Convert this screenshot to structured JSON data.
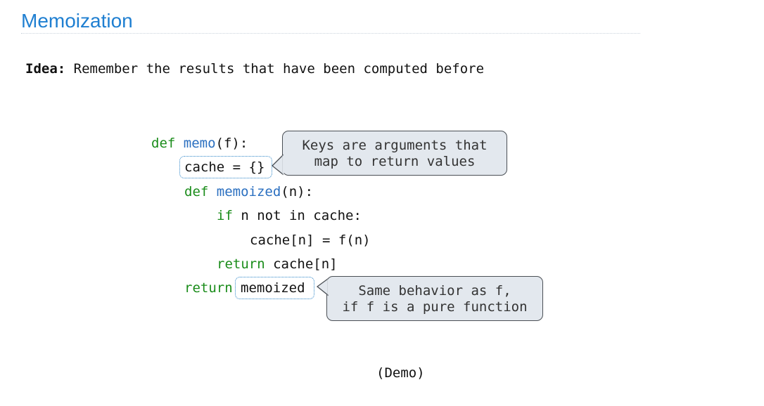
{
  "slide": {
    "title": "Memoization",
    "idea_label": "Idea:",
    "idea_text": " Remember the results that have been computed before",
    "demo": "(Demo)"
  },
  "code": {
    "l1_def": "def",
    "l1_name": "memo",
    "l1_rest": "(f):",
    "l2_text": "cache = {}",
    "l3_def": "def",
    "l3_name": "memoized",
    "l3_rest": "(n):",
    "l4_if": "if",
    "l4_rest": " n not in cache:",
    "l5_text": "cache[n] = f(n)",
    "l6_return": "return",
    "l6_rest": " cache[n]",
    "l7_return": "return",
    "l7_text": "memoized"
  },
  "callouts": {
    "keys": "Keys are arguments that\nmap to return values",
    "same": "Same behavior as f,\nif f is a pure function"
  },
  "colors": {
    "title": "#1f7fd1",
    "keyword": "#1a8c1a",
    "function_name": "#2a6fc0",
    "highlight_border": "#2e86c8",
    "bubble_fill": "#e3e8ee"
  }
}
